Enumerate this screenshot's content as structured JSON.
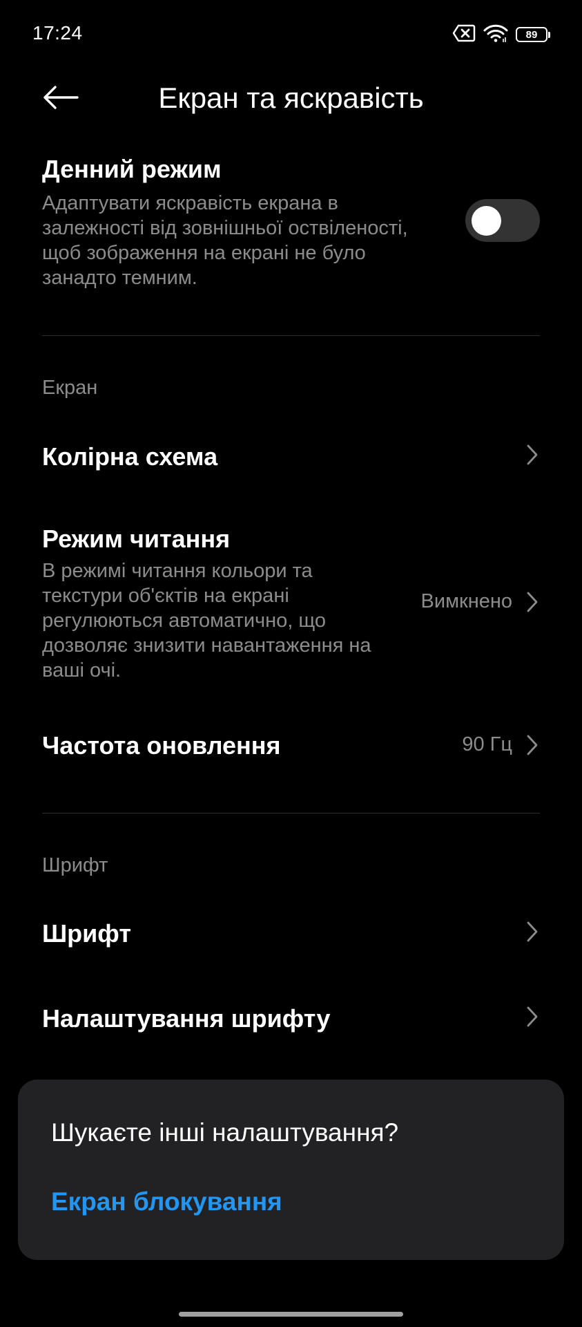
{
  "status_bar": {
    "time": "17:24",
    "battery": "89",
    "icons": [
      "sim-disabled-icon",
      "wifi-icon",
      "battery-icon"
    ]
  },
  "header": {
    "title": "Екран та яскравість",
    "back_icon": "arrow-left-icon"
  },
  "daylight_mode": {
    "title": "Денний режим",
    "description": "Адаптувати яскравість екрана в залежності від зовнішньої оствіленості, щоб зображення на екрані не було занадто темним.",
    "description_lines": [
      "Адаптувати яскравість екрана в",
      "залежності від зовнішньої оствіленості,",
      "щоб зображення на екрані не було",
      "занадто темним."
    ],
    "enabled": false
  },
  "section_screen": {
    "label": "Екран",
    "items": [
      {
        "title": "Колірна схема",
        "value": ""
      },
      {
        "title": "Режим читання",
        "description_lines": [
          "В режимі читання кольори та",
          "текстури об'єктів на екрані",
          "регулюються автоматично, що",
          "дозволяє знизити навантаження на",
          "ваші очі."
        ],
        "value": "Вимкнено"
      },
      {
        "title": "Частота оновлення",
        "value": "90 Гц"
      }
    ]
  },
  "section_font": {
    "label": "Шрифт",
    "items": [
      {
        "title": "Шрифт"
      },
      {
        "title": "Налаштування шрифту"
      }
    ]
  },
  "suggestion_card": {
    "title": "Шукаєте інші налаштування?",
    "link": "Екран блокування"
  },
  "colors": {
    "background": "#000000",
    "accent": "#2196f3",
    "secondary_text": "#8c8c8c"
  }
}
